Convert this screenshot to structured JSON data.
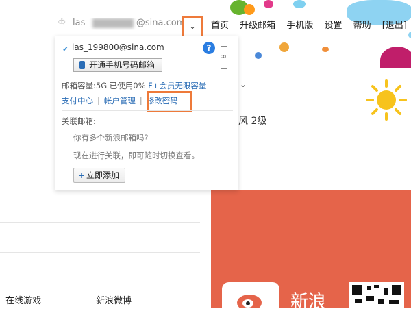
{
  "topbar": {
    "crown_icon": "crown-icon",
    "user_prefix": "las_",
    "user_suffix": "@sina.com",
    "dropdown_glyph": "⌄",
    "nav": [
      "首页",
      "升级邮箱",
      "手机版",
      "设置",
      "帮助",
      "[退出]"
    ]
  },
  "popup": {
    "email": "las_199800@sina.com",
    "help": "?",
    "phone_button": "开通手机号码邮箱",
    "capacity_prefix": "邮箱容量:5G 已使用0%",
    "capacity_vip": "F+会员无限容量",
    "links": [
      "支付中心",
      "帐户管理",
      "修改密码"
    ],
    "assoc_label": "关联邮箱:",
    "assoc_question": "你有多个新浪邮箱吗?",
    "assoc_desc": "现在进行关联，即可随时切换查看。",
    "add_button": "立即添加"
  },
  "main": {
    "weather_arrow": "⌄",
    "weather_text": "风 2级",
    "weibo_text": "新浪",
    "bottom_links": [
      "在线游戏",
      "新浪微博"
    ]
  },
  "colors": {
    "accent_highlight": "#ee7a3a",
    "link_blue": "#2a6cb5",
    "panel_orange": "#e5644a"
  }
}
